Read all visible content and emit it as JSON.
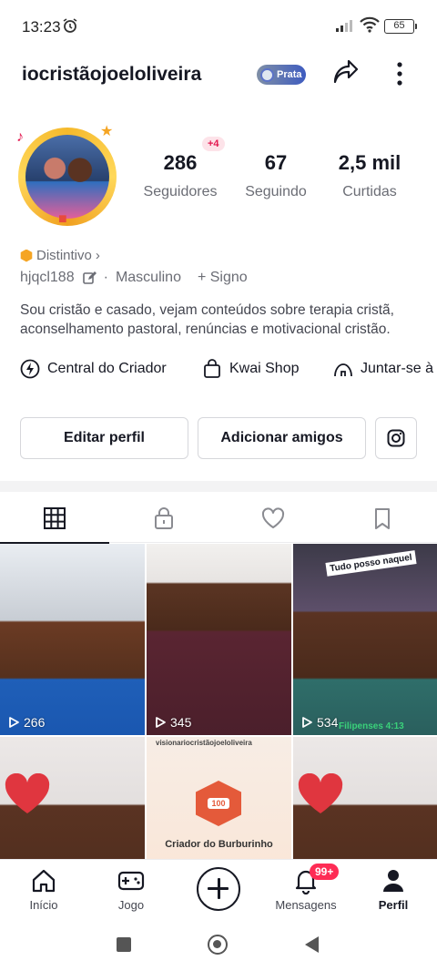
{
  "status_bar": {
    "time": "13:23",
    "battery": "65"
  },
  "header": {
    "username": "iocristãojoeloliveira",
    "rank_badge": "Prata"
  },
  "profile": {
    "followers_bonus": "+4",
    "stats": [
      {
        "value": "286",
        "label": "Seguidores"
      },
      {
        "value": "67",
        "label": "Seguindo"
      },
      {
        "value": "2,5 mil",
        "label": "Curtidas"
      }
    ],
    "badge_label": "Distintivo",
    "handle": "hjqcl188",
    "gender": "Masculino",
    "sign": "+ Signo",
    "bio": "Sou cristão e casado, vejam conteúdos sobre terapia cristã, aconselhamento pastoral, renúncias e motivacional cristão."
  },
  "links": [
    {
      "label": "Central do Criador",
      "icon": "lightning-icon"
    },
    {
      "label": "Kwai Shop",
      "icon": "shopping-bag-icon"
    },
    {
      "label": "Juntar-se à",
      "icon": "group-icon"
    }
  ],
  "actions": {
    "edit": "Editar perfil",
    "add_friends": "Adicionar amigos"
  },
  "tabs": [
    "grid-icon",
    "lock-icon",
    "heart-icon",
    "bookmark-icon"
  ],
  "videos": [
    {
      "views": "266"
    },
    {
      "views": "345"
    },
    {
      "views": "534",
      "overlay_top": "Tudo posso naquel",
      "overlay_bottom": "Filipenses 4:13"
    },
    {
      "views": ""
    },
    {
      "views": "",
      "overlay_top": "visionariocristãojoeloliveira",
      "overlay_bottom": "Criador do Burburinho",
      "badge": "100"
    },
    {
      "views": ""
    }
  ],
  "bottom_nav": {
    "home": "Início",
    "game": "Jogo",
    "messages": "Mensagens",
    "messages_badge": "99+",
    "profile": "Perfil"
  }
}
